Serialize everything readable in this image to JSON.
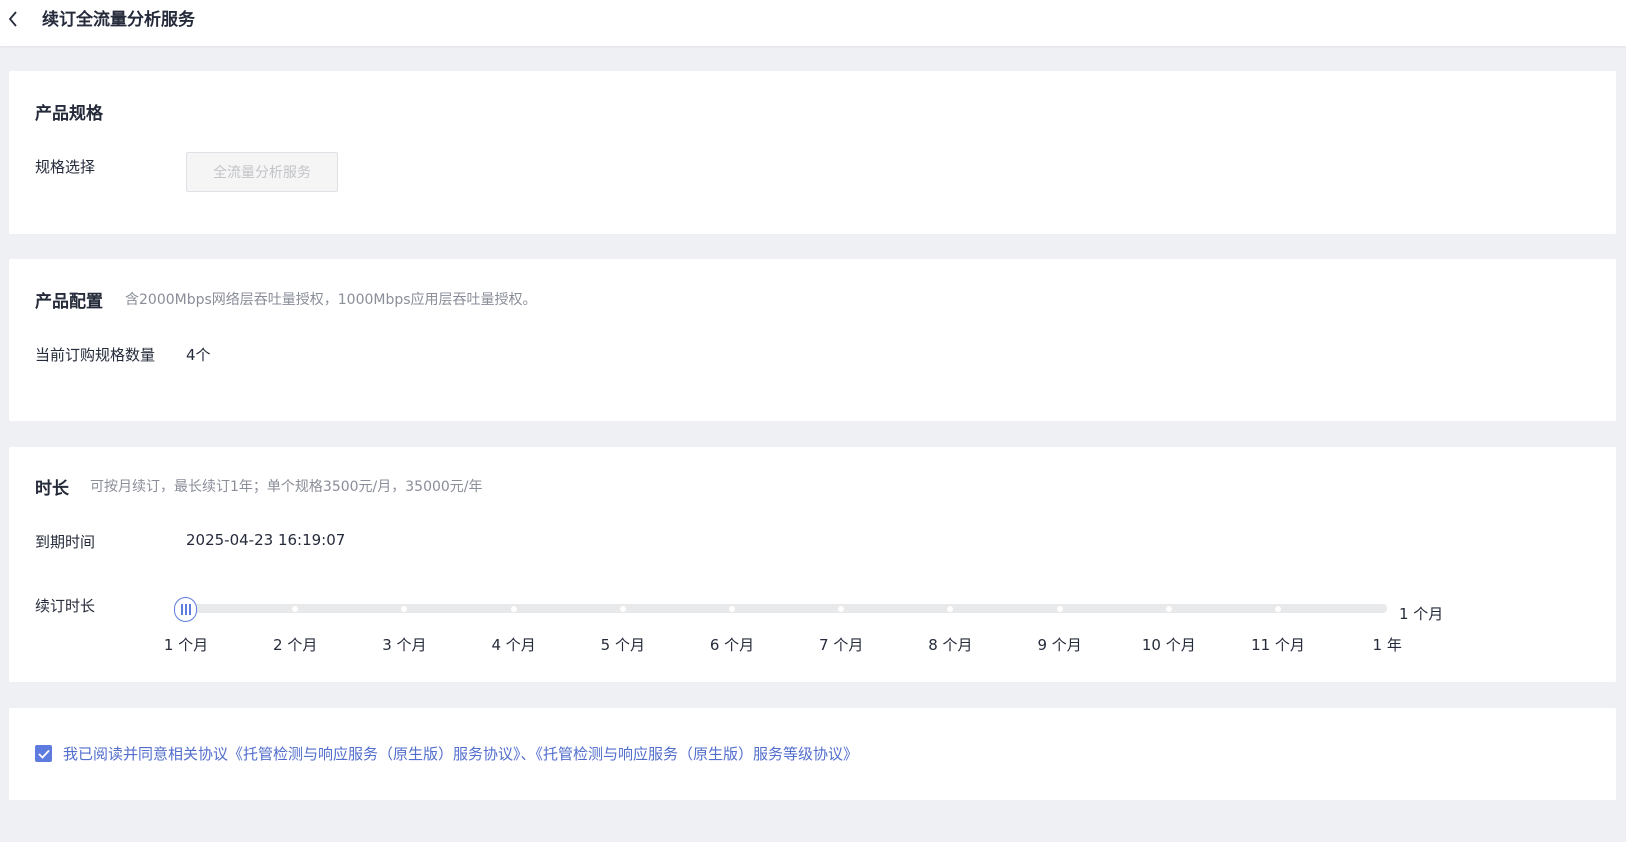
{
  "header": {
    "title": "续订全流量分析服务",
    "back_icon": "chevron-left-icon"
  },
  "spec_card": {
    "title": "产品规格",
    "spec_label": "规格选择",
    "spec_value": "全流量分析服务"
  },
  "config_card": {
    "title": "产品配置",
    "hint": "含2000Mbps网络层吞吐量授权，1000Mbps应用层吞吐量授权。",
    "quantity_label": "当前订购规格数量",
    "quantity_value": "4个"
  },
  "duration_card": {
    "title": "时长",
    "hint": "可按月续订，最长续订1年；单个规格3500元/月，35000元/年",
    "expire_label": "到期时间",
    "expire_value": "2025-04-23 16:19:07",
    "renew_label": "续订时长",
    "slider": {
      "ticks": [
        "1 个月",
        "2 个月",
        "3 个月",
        "4 个月",
        "5 个月",
        "6 个月",
        "7 个月",
        "8 个月",
        "9 个月",
        "10 个月",
        "11 个月",
        "1 年"
      ],
      "selected_index": 0,
      "selected_label": "1 个月"
    }
  },
  "agreement": {
    "checked": true,
    "prefix": "我已阅读并同意相关协议",
    "link1": "《托管检测与响应服务（原生版）服务协议》",
    "separator": "、",
    "link2": "《托管检测与响应服务（原生版）服务等级协议》"
  },
  "colors": {
    "accent": "#5e7ce0",
    "link": "#526ecc",
    "hint": "#8a8e99",
    "background": "#eef0f3"
  }
}
